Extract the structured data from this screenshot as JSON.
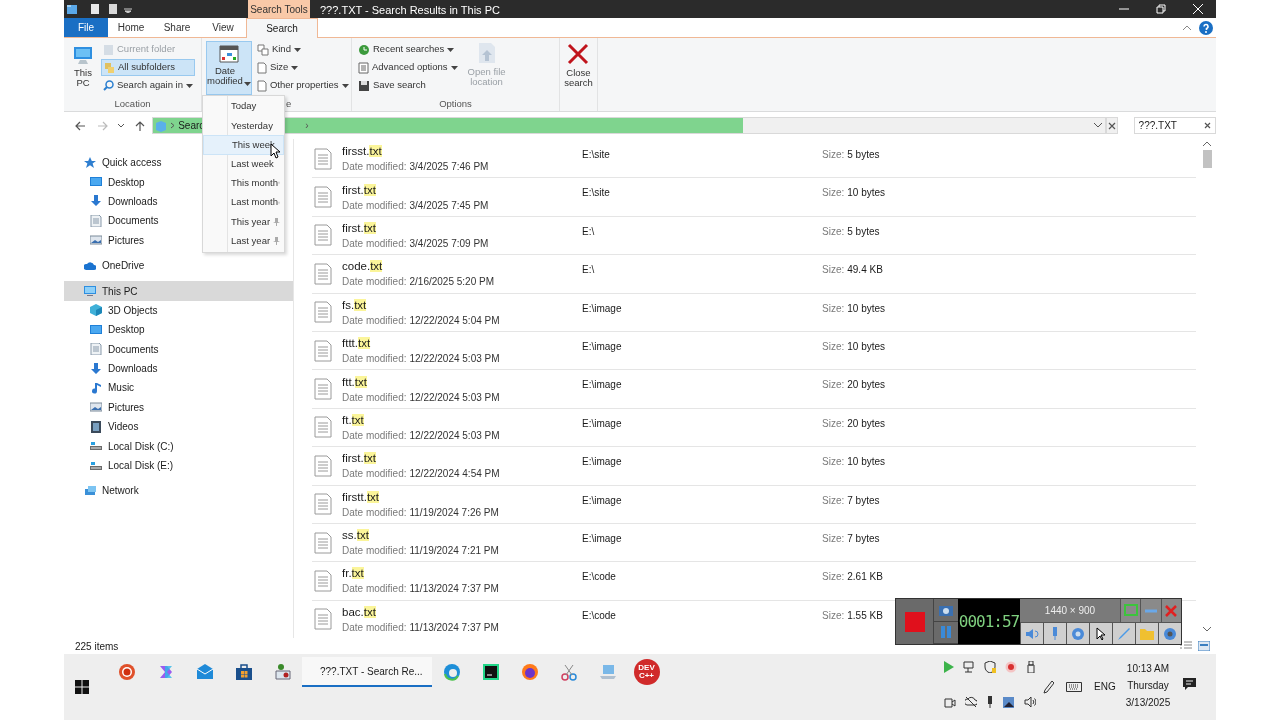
{
  "title_bar": {
    "context_tab": "Search Tools",
    "title": "???.TXT - Search Results in This PC"
  },
  "ribbon_tabs": [
    {
      "label": "File",
      "kind": "file",
      "selected": false
    },
    {
      "label": "Home",
      "kind": "tab",
      "selected": false
    },
    {
      "label": "Share",
      "kind": "tab",
      "selected": false
    },
    {
      "label": "View",
      "kind": "tab",
      "selected": false
    },
    {
      "label": "Search",
      "kind": "tab",
      "selected": true
    }
  ],
  "ribbon": {
    "location": {
      "label": "Location",
      "this_pc": "This\nPC",
      "current_folder": {
        "label": "Current folder",
        "disabled": true
      },
      "all_subfolders": {
        "label": "All subfolders",
        "selected": true
      },
      "search_again": "Search again in"
    },
    "refine": {
      "label": "e",
      "date_modified": {
        "label": "Date\nmodified",
        "expanded": true
      },
      "kind": "Kind",
      "size": "Size",
      "other": "Other properties"
    },
    "options": {
      "label": "Options",
      "recent": "Recent searches",
      "advanced": "Advanced options",
      "save": "Save search",
      "open_location": {
        "label": "Open file\nlocation",
        "disabled": true
      },
      "close": "Close\nsearch"
    }
  },
  "address_bar": {
    "path": "Searc",
    "separator": "›",
    "level": 0.62
  },
  "search_box": {
    "value": "???.TXT"
  },
  "date_menu": [
    {
      "label": "Today",
      "selected": false,
      "pinned": false
    },
    {
      "label": "Yesterday",
      "selected": false,
      "pinned": false
    },
    {
      "label": "This week",
      "selected": true,
      "pinned": false
    },
    {
      "label": "Last week",
      "selected": false,
      "pinned": false
    },
    {
      "label": "This month",
      "selected": false,
      "pinned": true
    },
    {
      "label": "Last month",
      "selected": false,
      "pinned": true
    },
    {
      "label": "This year",
      "selected": false,
      "pinned": true
    },
    {
      "label": "Last year",
      "selected": false,
      "pinned": true
    }
  ],
  "navigation": [
    {
      "label": "Quick access",
      "kind": "star",
      "selected": false,
      "children": [
        {
          "label": "Desktop",
          "kind": "desktop",
          "selected": false
        },
        {
          "label": "Downloads",
          "kind": "download",
          "selected": false
        },
        {
          "label": "Documents",
          "kind": "document",
          "selected": false
        },
        {
          "label": "Pictures",
          "kind": "pictures",
          "selected": false
        }
      ]
    },
    {
      "label": "OneDrive",
      "kind": "cloud",
      "selected": false
    },
    {
      "label": "This PC",
      "kind": "pc",
      "selected": true,
      "children": [
        {
          "label": "3D Objects",
          "kind": "cube",
          "selected": false
        },
        {
          "label": "Desktop",
          "kind": "desktop",
          "selected": false
        },
        {
          "label": "Documents",
          "kind": "document",
          "selected": false
        },
        {
          "label": "Downloads",
          "kind": "download",
          "selected": false
        },
        {
          "label": "Music",
          "kind": "music",
          "selected": false
        },
        {
          "label": "Pictures",
          "kind": "pictures",
          "selected": false
        },
        {
          "label": "Videos",
          "kind": "video",
          "selected": false
        },
        {
          "label": "Local Disk (C:)",
          "kind": "disk",
          "selected": false
        },
        {
          "label": "Local Disk (E:)",
          "kind": "disk",
          "selected": false
        }
      ]
    },
    {
      "label": "Network",
      "kind": "network",
      "selected": false
    }
  ],
  "results": {
    "rows": [
      {
        "stem": "firsst.",
        "match": "txt",
        "date_label": "Date modified:",
        "date": "3/4/2025 7:46 PM",
        "location": "E:\\site",
        "size_label": "Size:",
        "size": "5 bytes"
      },
      {
        "stem": "first.",
        "match": "txt",
        "date_label": "Date modified:",
        "date": "3/4/2025 7:45 PM",
        "location": "E:\\site",
        "size_label": "Size:",
        "size": "10 bytes"
      },
      {
        "stem": "first.",
        "match": "txt",
        "date_label": "Date modified:",
        "date": "3/4/2025 7:09 PM",
        "location": "E:\\",
        "size_label": "Size:",
        "size": "5 bytes"
      },
      {
        "stem": "code.",
        "match": "txt",
        "date_label": "Date modified:",
        "date": "2/16/2025 5:20 PM",
        "location": "E:\\",
        "size_label": "Size:",
        "size": "49.4 KB"
      },
      {
        "stem": "fs.",
        "match": "txt",
        "date_label": "Date modified:",
        "date": "12/22/2024 5:04 PM",
        "location": "E:\\image",
        "size_label": "Size:",
        "size": "10 bytes"
      },
      {
        "stem": "fttt.",
        "match": "txt",
        "date_label": "Date modified:",
        "date": "12/22/2024 5:03 PM",
        "location": "E:\\image",
        "size_label": "Size:",
        "size": "10 bytes"
      },
      {
        "stem": "ftt.",
        "match": "txt",
        "date_label": "Date modified:",
        "date": "12/22/2024 5:03 PM",
        "location": "E:\\image",
        "size_label": "Size:",
        "size": "20 bytes"
      },
      {
        "stem": "ft.",
        "match": "txt",
        "date_label": "Date modified:",
        "date": "12/22/2024 5:03 PM",
        "location": "E:\\image",
        "size_label": "Size:",
        "size": "20 bytes"
      },
      {
        "stem": "first.",
        "match": "txt",
        "date_label": "Date modified:",
        "date": "12/22/2024 4:54 PM",
        "location": "E:\\image",
        "size_label": "Size:",
        "size": "10 bytes"
      },
      {
        "stem": "firstt.",
        "match": "txt",
        "date_label": "Date modified:",
        "date": "11/19/2024 7:26 PM",
        "location": "E:\\image",
        "size_label": "Size:",
        "size": "7 bytes"
      },
      {
        "stem": "ss.",
        "match": "txt",
        "date_label": "Date modified:",
        "date": "11/19/2024 7:21 PM",
        "location": "E:\\image",
        "size_label": "Size:",
        "size": "7 bytes"
      },
      {
        "stem": "fr.",
        "match": "txt",
        "date_label": "Date modified:",
        "date": "11/13/2024 7:37 PM",
        "location": "E:\\code",
        "size_label": "Size:",
        "size": "2.61 KB"
      },
      {
        "stem": "bac.",
        "match": "txt",
        "date_label": "Date modified:",
        "date": "11/13/2024 7:37 PM",
        "location": "E:\\code",
        "size_label": "Size:",
        "size": "1.55 KB"
      }
    ]
  },
  "status_bar": {
    "count": "225 items"
  },
  "recorder": {
    "timer": "0001:57",
    "resolution": "1440 × 900"
  },
  "taskbar": {
    "apps": [
      {
        "kind": "recorder"
      },
      {
        "kind": "copilot"
      },
      {
        "kind": "mail"
      },
      {
        "kind": "store"
      },
      {
        "kind": "tool"
      },
      {
        "kind": "window",
        "label": "???.TXT - Search Re...",
        "selected": true
      },
      {
        "kind": "edge"
      },
      {
        "kind": "pycharm"
      },
      {
        "kind": "firefox"
      },
      {
        "kind": "snip"
      },
      {
        "kind": "laptop"
      },
      {
        "kind": "devcpp",
        "label": "DEV\nC++"
      }
    ],
    "language": "ENG",
    "time": "10:13 AM",
    "day": "Thursday",
    "date": "3/13/2025"
  }
}
